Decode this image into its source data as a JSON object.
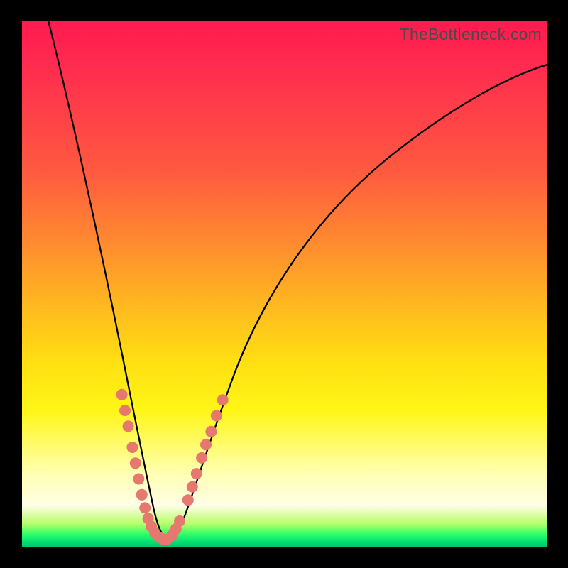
{
  "watermark": "TheBottleneck.com",
  "colors": {
    "frame": "#000000",
    "curve": "#000000",
    "dots": "#e6786f",
    "gradient_top": "#ff1a4f",
    "gradient_bottom": "#00c06a"
  },
  "chart_data": {
    "type": "line",
    "title": "",
    "xlabel": "",
    "ylabel": "",
    "xlim": [
      0,
      100
    ],
    "ylim": [
      0,
      100
    ],
    "note": "Axes unlabeled in image; values approximate by pixel position. Y increases upward; bottleneck minimum near x≈26.",
    "series": [
      {
        "name": "bottleneck-curve",
        "x": [
          5,
          8,
          12,
          16,
          19,
          21,
          23,
          24.5,
          26,
          27.5,
          29,
          31,
          34,
          38,
          44,
          52,
          62,
          75,
          90,
          100
        ],
        "y": [
          100,
          85,
          65,
          45,
          30,
          19,
          10,
          5,
          2,
          1.5,
          3,
          7,
          16,
          28,
          43,
          58,
          70,
          80,
          87,
          91
        ]
      }
    ],
    "markers": {
      "name": "sample-dots",
      "points": [
        {
          "x": 19.0,
          "y": 29
        },
        {
          "x": 19.6,
          "y": 26
        },
        {
          "x": 20.2,
          "y": 23
        },
        {
          "x": 21.0,
          "y": 19
        },
        {
          "x": 21.6,
          "y": 16
        },
        {
          "x": 22.2,
          "y": 13
        },
        {
          "x": 22.8,
          "y": 10
        },
        {
          "x": 23.4,
          "y": 7.5
        },
        {
          "x": 24.0,
          "y": 5.5
        },
        {
          "x": 24.6,
          "y": 4
        },
        {
          "x": 25.3,
          "y": 2.7
        },
        {
          "x": 26.0,
          "y": 2
        },
        {
          "x": 26.8,
          "y": 1.6
        },
        {
          "x": 27.6,
          "y": 1.5
        },
        {
          "x": 28.6,
          "y": 2.3
        },
        {
          "x": 29.3,
          "y": 3.5
        },
        {
          "x": 30.0,
          "y": 5
        },
        {
          "x": 31.6,
          "y": 9
        },
        {
          "x": 32.4,
          "y": 11.5
        },
        {
          "x": 33.2,
          "y": 14
        },
        {
          "x": 34.2,
          "y": 17
        },
        {
          "x": 35.0,
          "y": 19.5
        },
        {
          "x": 36.0,
          "y": 22
        },
        {
          "x": 37.0,
          "y": 25
        },
        {
          "x": 38.2,
          "y": 28
        }
      ]
    }
  }
}
